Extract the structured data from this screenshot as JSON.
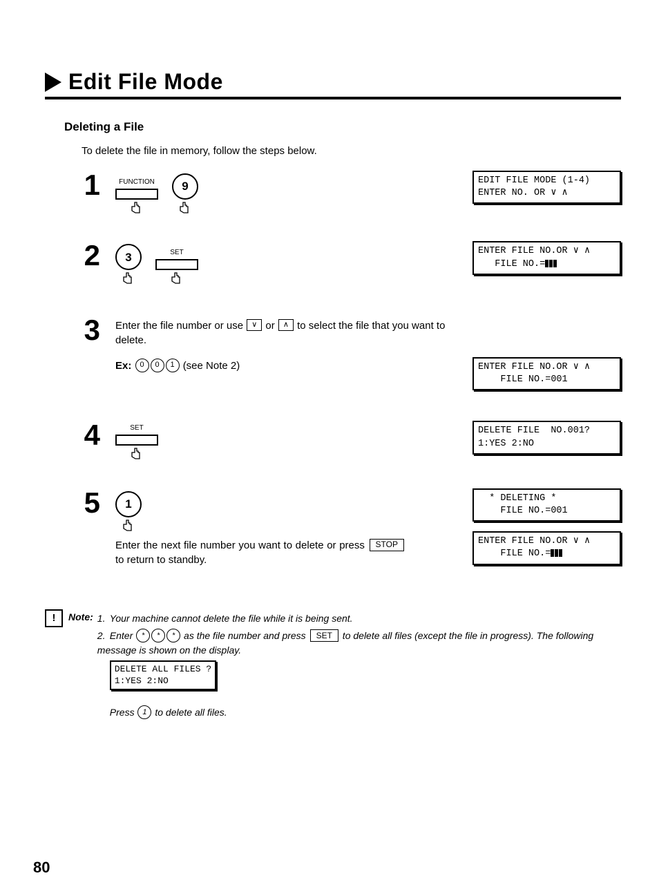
{
  "title": "Edit File Mode",
  "subhead": "Deleting a File",
  "intro": "To delete the file in memory, follow the steps below.",
  "labels": {
    "function": "FUNCTION",
    "set": "SET",
    "stop": "STOP",
    "ex": "Ex:",
    "seeNote2": "(see Note 2)"
  },
  "steps": {
    "s1": {
      "num": "1",
      "key": "9",
      "lcd": "EDIT FILE MODE (1-4)\nENTER NO. OR ∨ ∧"
    },
    "s2": {
      "num": "2",
      "key": "3",
      "lcd": "ENTER FILE NO.OR ∨ ∧\n   FILE NO.="
    },
    "s3": {
      "num": "3",
      "text_a": "Enter the file number or use ",
      "text_b": " or ",
      "text_c": " to select the file that you want to delete.",
      "exKeys": [
        "0",
        "0",
        "1"
      ],
      "lcd": "ENTER FILE NO.OR ∨ ∧\n    FILE NO.=001"
    },
    "s4": {
      "num": "4",
      "lcd": "DELETE FILE  NO.001?\n1:YES 2:NO"
    },
    "s5": {
      "num": "5",
      "key": "1",
      "lcd_a": "  * DELETING *\n    FILE NO.=001",
      "lcd_b": "ENTER FILE NO.OR ∨ ∧\n    FILE NO.=",
      "follow_a": "Enter the next file number you want to delete or press ",
      "follow_b": " to return to standby."
    }
  },
  "note": {
    "label": "Note:",
    "n1": "Your machine cannot delete the file while it is being sent.",
    "n2_a": "Enter ",
    "n2_b": " as the file number and press ",
    "n2_c": " to delete all files (except the file in progress). The following message is shown on the display.",
    "n2_lcd": "DELETE ALL FILES ?\n1:YES 2:NO",
    "n2_d": "Press ",
    "n2_e": " to delete all files.",
    "starKeys": [
      "*",
      "*",
      "*"
    ],
    "pressKey": "1"
  },
  "page": "80"
}
